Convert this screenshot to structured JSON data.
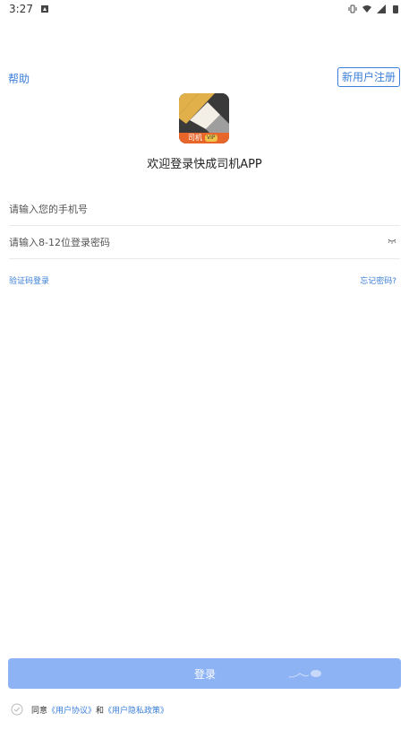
{
  "status_bar": {
    "time": "3:27",
    "icons": [
      "notification-icon",
      "vibrate-icon",
      "wifi-icon",
      "signal-icon",
      "battery-icon"
    ]
  },
  "header": {
    "help_label": "帮助",
    "register_label": "新用户注册"
  },
  "logo": {
    "badge_text": "司机",
    "badge_sub": "VIP"
  },
  "welcome_text": "欢迎登录快成司机APP",
  "form": {
    "phone_placeholder": "请输入您的手机号",
    "password_placeholder": "请输入8-12位登录密码"
  },
  "links": {
    "code_login": "验证码登录",
    "forgot_password": "忘记密码?"
  },
  "login_button_label": "登录",
  "agreement": {
    "prefix": "同意",
    "user_agreement": "《用户协议》",
    "conjunction": "和",
    "privacy_policy": "《用户隐私政策》"
  },
  "colors": {
    "accent": "#3b7fd8",
    "login_button": "#8db3f5",
    "logo_orange": "#e8662a",
    "logo_gold": "#e1b04a"
  }
}
